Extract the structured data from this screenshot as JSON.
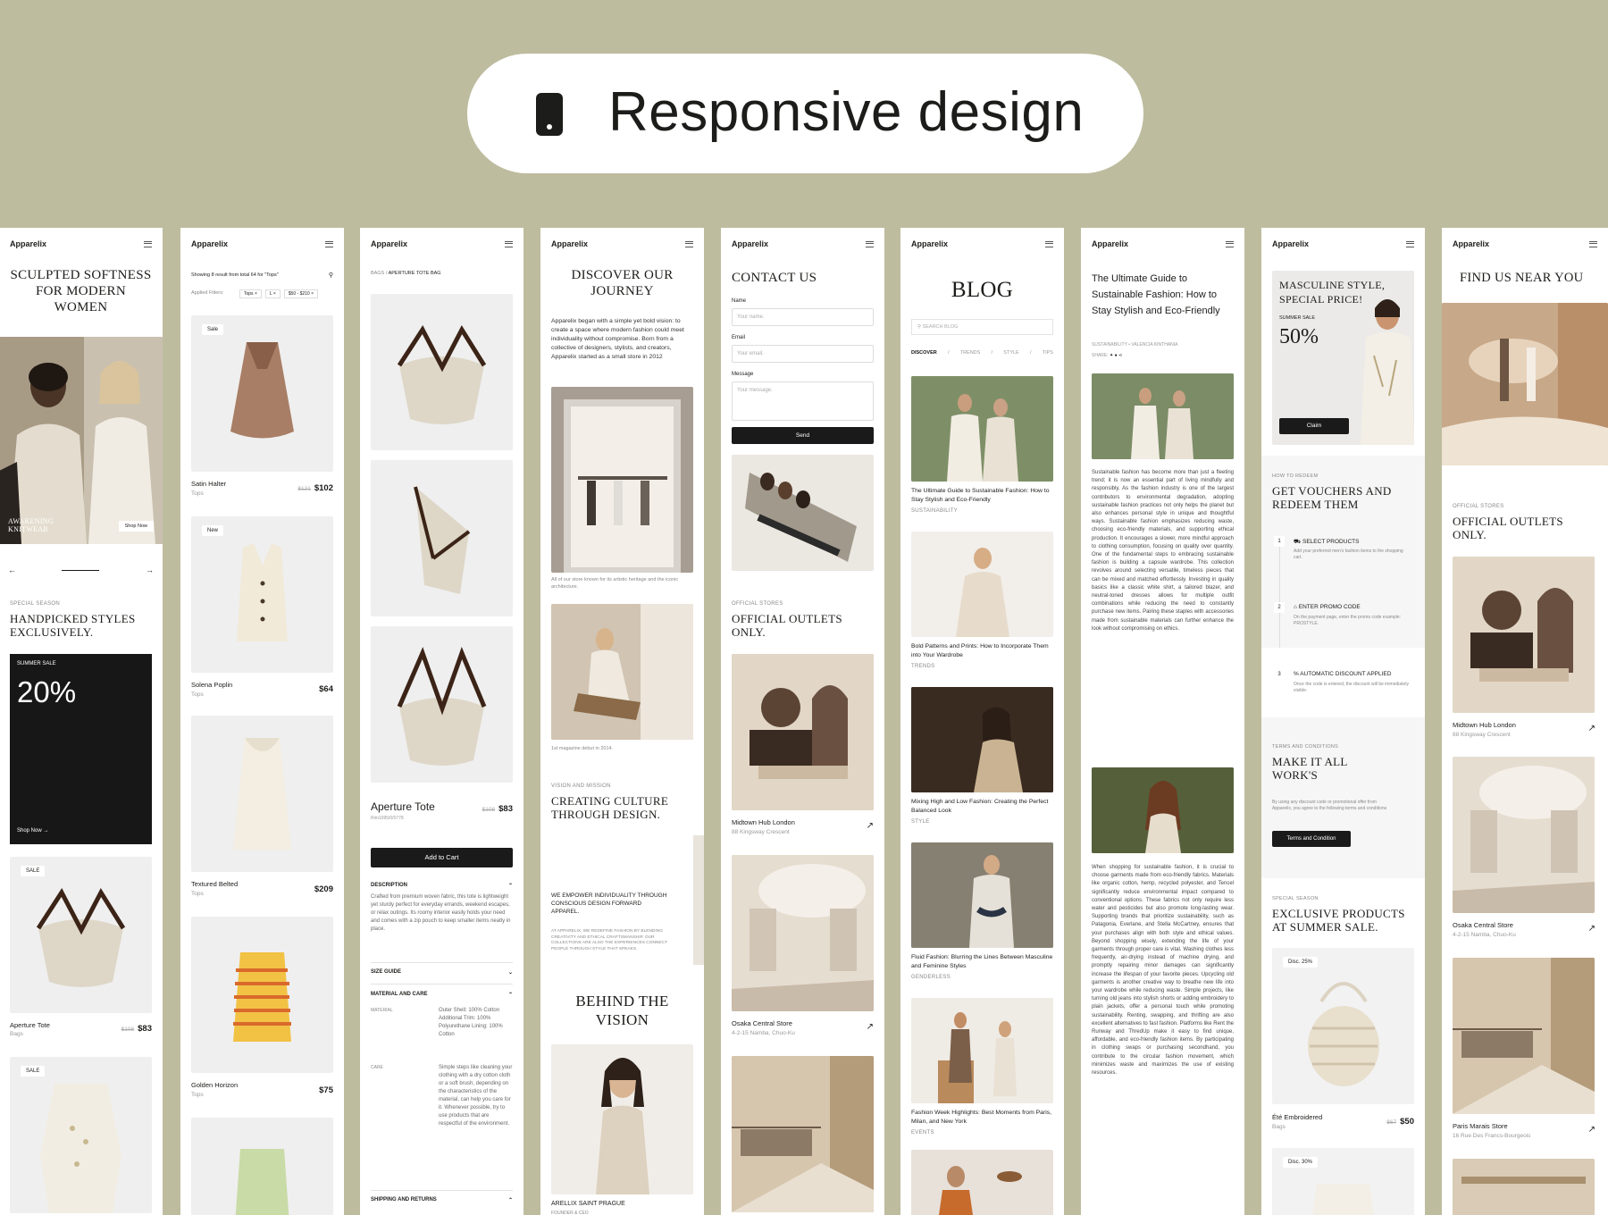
{
  "banner": {
    "title": "Responsive design",
    "icon": "mobile-phone-icon"
  },
  "brand": "Apparelix",
  "s1": {
    "hero_title": "SCULPTED SOFTNESS FOR MODERN WOMEN",
    "hero_caption": "AWAKENING KNITWEAR",
    "shop_now": "Shop Now",
    "eyebrow": "SPECIAL SEASON",
    "section_title": "HANDPICKED STYLES EXCLUSIVELY.",
    "promo_label": "SUMMER SALE",
    "promo_value": "20%",
    "promo_cta": "Shop Now",
    "sale_badge": "SALE",
    "p1_name": "Aperture Tote",
    "p1_cat": "Bags",
    "p1_old": "$108",
    "p1_price": "$83",
    "sale_badge2": "SALE"
  },
  "s2": {
    "showing": "Showing 8 result from total 64 for \"Tops\"",
    "applied": "Applied Filters:",
    "chips": [
      "Tops ×",
      "L ×",
      "$50 - $210 ×"
    ],
    "products": [
      {
        "badge": "Sale",
        "name": "Satin Halter",
        "cat": "Tops",
        "old": "$121",
        "price": "$102"
      },
      {
        "badge": "New",
        "name": "Solena Poplin",
        "cat": "Tops",
        "old": "",
        "price": "$64"
      },
      {
        "badge": "",
        "name": "Textured Belted",
        "cat": "Tops",
        "old": "",
        "price": "$209"
      },
      {
        "badge": "",
        "name": "Golden Horizon",
        "cat": "Tops",
        "old": "",
        "price": "$75"
      }
    ]
  },
  "s3": {
    "crumb_1": "BAGS",
    "crumb_2": "APERTURE TOTE BAG",
    "name": "Aperture Tote",
    "sku": "Rim1095/0/0778",
    "old": "$108",
    "price": "$83",
    "add_to_cart": "Add to Cart",
    "desc_head": "DESCRIPTION",
    "desc": "Crafted from premium woven fabric, this tote is lightweight yet sturdy perfect for everyday errands, weekend escapes, or relax outings. Its roomy interior easily holds your need and comes with a zip pouch to keep smaller items neatly in place.",
    "size_head": "SIZE GUIDE",
    "material_head": "MATERIAL AND CARE",
    "material_label": "MATERIAL",
    "material_val": "Outer Shell: 100% Cotton Additional Trim: 100% Polyurethane Lining: 100% Cotton",
    "care_label": "CARE",
    "care_val": "Simple steps like cleaning your clothing with a dry cotton cloth or a soft brush, depending on the characteristics of the material, can help you care for it. Whenever possible, try to use products that are respectful of the environment.",
    "ship_head": "SHIPPING AND RETURNS"
  },
  "s4": {
    "title": "DISCOVER OUR JOURNEY",
    "intro": "Apparelix began with a simple yet bold vision: to create a space where modern fashion could meet individuality without compromise. Born from a collective of designers, stylists, and creators, Apparelix started as a small store in 2012",
    "cap1": "All of our store known for its artistic heritage and the iconic architecture.",
    "cap2": "1st magazine debut in 2014.",
    "eyebrow": "VISION AND MISSION",
    "h2": "CREATING CULTURE THROUGH DESIGN.",
    "empower": "WE EMPOWER INDIVIDUALITY THROUGH CONSCIOUS DESIGN FORWARD APPAREL.",
    "empower_sub": "AT APPARELIX, WE REDEFINE FASHION BY BLENDING CREATIVITY AND ETHICAL CRAFTSMANSHIP. OUR COLLECTIONS ARE ALSO THE EXPERIENCES CONNECT PEOPLE THROUGH STYLE THAT SPEAKS.",
    "behind": "BEHIND THE VISION",
    "person": "ARELLIX SAINT PRAGUE",
    "role": "FOUNDER & CEO"
  },
  "s5": {
    "title": "CONTACT US",
    "name_label": "Name",
    "name_ph": "Your name.",
    "email_label": "Email",
    "email_ph": "Your email.",
    "msg_label": "Message",
    "msg_ph": "Your message.",
    "send": "Send",
    "eyebrow": "OFFICIAL STORES",
    "h2": "OFFICIAL OUTLETS ONLY.",
    "stores": [
      {
        "name": "Midtown Hub London",
        "addr": "88 Kingsway Crescent"
      },
      {
        "name": "Osaka Central Store",
        "addr": "4-2-15 Namba, Chuo-Ku"
      }
    ]
  },
  "s6": {
    "title": "BLOG",
    "search_ph": "SEARCH BLOG",
    "tabs": [
      "DISCOVER",
      "TRENDS",
      "STYLE",
      "TIPS"
    ],
    "posts": [
      {
        "title": "The Ultimate Guide to Sustainable Fashion: How to Stay Stylish and Eco-Friendly",
        "tag": "SUSTAINABILITY"
      },
      {
        "title": "Bold Patterns and Prints: How to Incorporate Them into Your Wardrobe",
        "tag": "TRENDS"
      },
      {
        "title": "Mixing High and Low Fashion: Creating the Perfect Balanced Look",
        "tag": "STYLE"
      },
      {
        "title": "Fluid Fashion: Blurring the Lines Between Masculine and Feminine Styles",
        "tag": "GENDERLESS"
      },
      {
        "title": "Fashion Week Highlights: Best Moments from Paris, Milan, and New York",
        "tag": "EVENTS"
      }
    ]
  },
  "s7": {
    "title": "The Ultimate Guide to Sustainable Fashion: How to Stay Stylish and Eco-Friendly",
    "meta_tag": "SUSTAINABILITY",
    "meta_author": "VALENCIA KINTHANIA",
    "share": "SHARE:",
    "p1": "Sustainable fashion has become more than just a fleeting trend; it is now an essential part of living mindfully and responsibly. As the fashion industry is one of the largest contributors to environmental degradation, adopting sustainable fashion practices not only helps the planet but also enhances personal style in unique and thoughtful ways. Sustainable fashion emphasizes reducing waste, choosing eco-friendly materials, and supporting ethical production. It encourages a slower, more mindful approach to clothing consumption, focusing on quality over quantity. One of the fundamental steps to embracing sustainable fashion is building a capsule wardrobe. This collection revolves around selecting versatile, timeless pieces that can be mixed and matched effortlessly. Investing in quality basics like a classic white shirt, a tailored blazer, and neutral-toned dresses allows for multiple outfit combinations while reducing the need to constantly purchase new items. Pairing these staples with accessories made from sustainable materials can further enhance the look without compromising on ethics.",
    "p2": "When shopping for sustainable fashion, it is crucial to choose garments made from eco-friendly fabrics. Materials like organic cotton, hemp, recycled polyester, and Tencel significantly reduce environmental impact compared to conventional options. These fabrics not only require less water and pesticides but also promote long-lasting wear. Supporting brands that prioritize sustainability, such as Patagonia, Everlane, and Stella McCartney, ensures that your purchases align with both style and ethical values. Beyond shopping wisely, extending the life of your garments through proper care is vital. Washing clothes less frequently, air-drying instead of machine drying, and promptly repairing minor damages can significantly increase the lifespan of your favorite pieces. Upcycling old garments is another creative way to breathe new life into your wardrobe while reducing waste. Simple projects, like turning old jeans into stylish shorts or adding embroidery to plain jackets, offer a personal touch while promoting sustainability. Renting, swapping, and thrifting are also excellent alternatives to fast fashion. Platforms like Rent the Runway and ThredUp make it easy to find unique, affordable, and eco-friendly fashion items. By participating in clothing swaps or purchasing secondhand, you contribute to the circular fashion movement, which minimizes waste and maximizes the use of existing resources."
  },
  "s8": {
    "hero": "MASCULINE STYLE, SPECIAL PRICE!",
    "sale_label": "SUMMER SALE",
    "sale_value": "50%",
    "claim": "Claim",
    "eyebrow": "HOW TO REDEEM",
    "h2": "GET VOUCHERS AND REDEEM THEM",
    "steps": [
      {
        "n": "1",
        "title": "SELECT PRODUCTS",
        "desc": "Add your preferred men's fashion items to the shopping cart."
      },
      {
        "n": "2",
        "title": "ENTER PROMO CODE",
        "desc": "On the payment page, enter the promo code example: PROSTYLE."
      },
      {
        "n": "3",
        "title": "AUTOMATIC DISCOUNT APPLIED",
        "desc": "Once the code is entered, the discount will be immediately visible."
      }
    ],
    "terms_eyebrow": "TERMS AND CONDITIONS",
    "terms_h2": "MAKE IT ALL WORK'S",
    "terms_text": "By using any discount code or promotional offer from Apparelix, you agree to the following terms and conditions",
    "terms_btn": "Terms and Condition",
    "ex_eyebrow": "SPECIAL SEASON",
    "ex_h2": "EXCLUSIVE PRODUCTS AT SUMMER SALE.",
    "disc1": "Disc. 25%",
    "prod_name": "Été Embroidered",
    "prod_cat": "Bags",
    "prod_old": "$67",
    "prod_price": "$50",
    "disc2": "Disc. 30%"
  },
  "s9": {
    "title": "FIND US NEAR YOU",
    "eyebrow": "OFFICIAL STORES",
    "h2": "OFFICIAL OUTLETS ONLY.",
    "stores": [
      {
        "name": "Midtown Hub London",
        "addr": "88 Kingsway Crescent"
      },
      {
        "name": "Osaka Central Store",
        "addr": "4-2-15 Namba, Chuo-Ku"
      },
      {
        "name": "Paris Marais Store",
        "addr": "16 Rue Des Francs-Bourgeois"
      }
    ]
  },
  "colors": {
    "background": "#bebc9f",
    "screen": "#ffffff",
    "dark": "#1a1a1a"
  }
}
